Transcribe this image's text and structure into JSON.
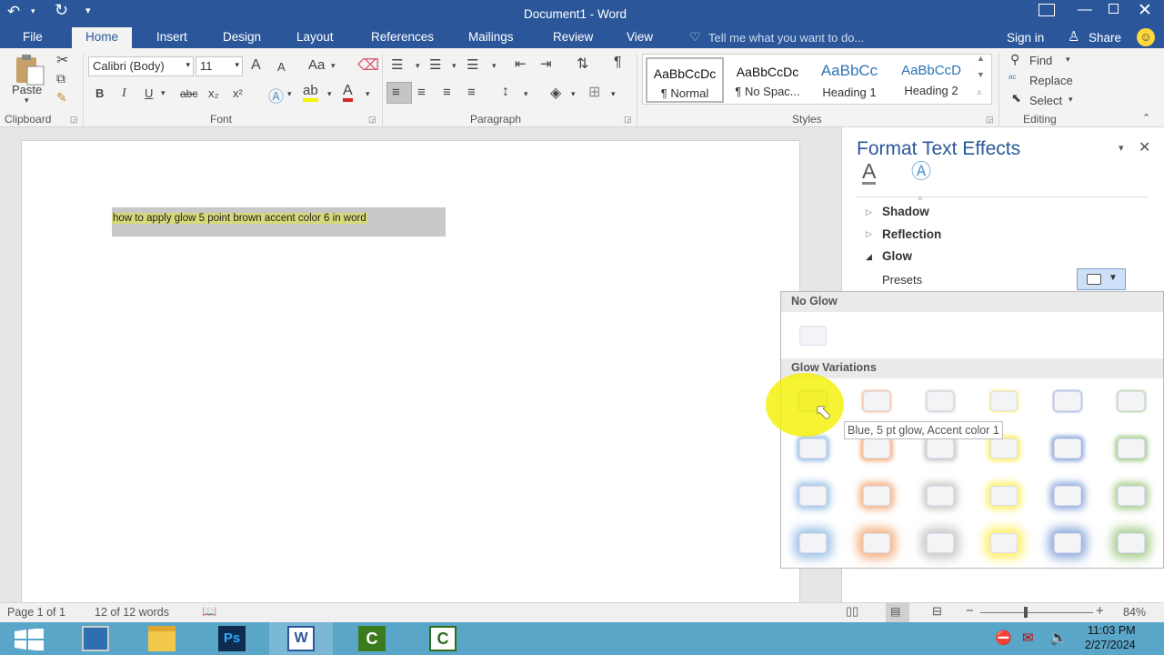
{
  "title_bar": {
    "title": "Document1 - Word"
  },
  "tabs": [
    {
      "label": "File"
    },
    {
      "label": "Home"
    },
    {
      "label": "Insert"
    },
    {
      "label": "Design"
    },
    {
      "label": "Layout"
    },
    {
      "label": "References"
    },
    {
      "label": "Mailings"
    },
    {
      "label": "Review"
    },
    {
      "label": "View"
    }
  ],
  "tell_me": "Tell me what you want to do...",
  "sign_in": "Sign in",
  "share": "Share",
  "ribbon": {
    "clipboard": {
      "paste": "Paste",
      "group": "Clipboard"
    },
    "font": {
      "name": "Calibri (Body)",
      "size": "11",
      "group": "Font",
      "case": "Aa",
      "bold": "B",
      "italic": "I",
      "underline": "U",
      "strike": "abc",
      "sub": "x₂",
      "sup": "x²",
      "grow": "A",
      "shrink": "A"
    },
    "paragraph": {
      "group": "Paragraph",
      "pilcrow": "¶"
    },
    "styles": {
      "group": "Styles",
      "items": [
        {
          "preview": "AaBbCcDc",
          "name": "¶ Normal"
        },
        {
          "preview": "AaBbCcDc",
          "name": "¶ No Spac..."
        },
        {
          "preview": "AaBbCc",
          "name": "Heading 1"
        },
        {
          "preview": "AaBbCcD",
          "name": "Heading 2"
        }
      ]
    },
    "editing": {
      "find": "Find",
      "replace": "Replace",
      "select": "Select",
      "group": "Editing"
    }
  },
  "document": {
    "selected_text": "how to apply glow 5 point brown accent color 6 in word"
  },
  "pane": {
    "title": "Format Text Effects",
    "sections": {
      "shadow": "Shadow",
      "reflection": "Reflection",
      "glow": "Glow"
    },
    "presets_label": "Presets"
  },
  "glow_popup": {
    "no_glow": "No Glow",
    "variations": "Glow Variations",
    "tooltip": "Blue, 5 pt glow, Accent color 1",
    "colors": [
      "#5b9bd5",
      "#ed7d31",
      "#a5a5a5",
      "#ffe600",
      "#4472c4",
      "#70ad47"
    ]
  },
  "status_bar": {
    "page": "Page 1 of 1",
    "words": "12 of 12 words",
    "zoom": "84%"
  },
  "taskbar": {
    "time": "11:03 PM",
    "date": "2/27/2024"
  }
}
